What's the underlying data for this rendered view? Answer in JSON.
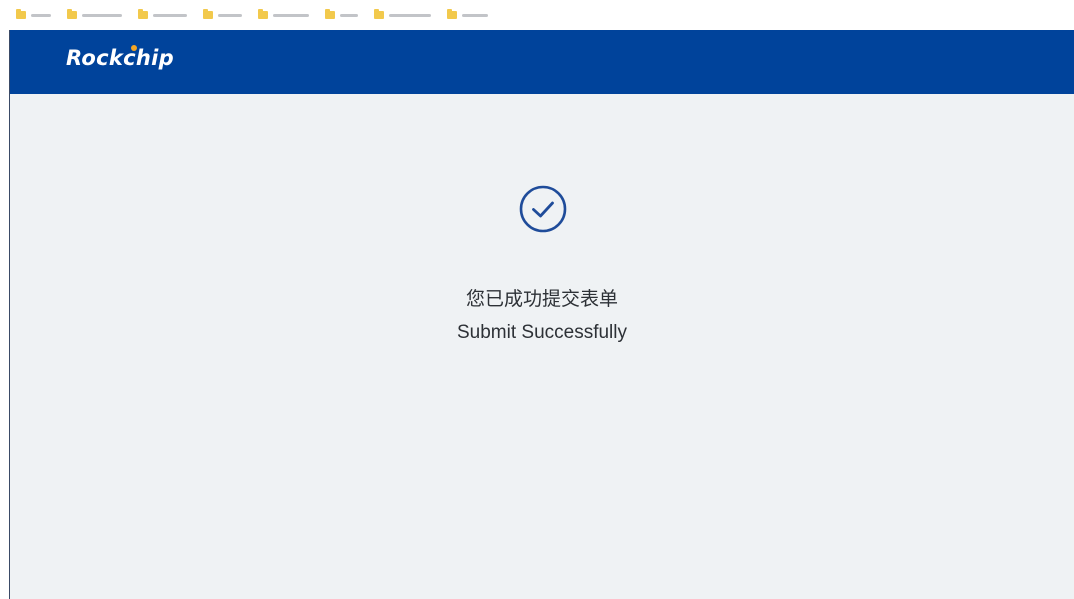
{
  "bookmarks_bar": {
    "items": [
      {
        "icon": "folder-icon"
      },
      {
        "icon": "folder-icon"
      },
      {
        "icon": "folder-icon"
      },
      {
        "icon": "folder-icon"
      },
      {
        "icon": "folder-icon"
      },
      {
        "icon": "folder-icon"
      },
      {
        "icon": "folder-icon"
      },
      {
        "icon": "folder-icon"
      }
    ]
  },
  "header": {
    "logo_text": "Rockchip",
    "background_color": "#00439b"
  },
  "main": {
    "icon": "check-circle-icon",
    "icon_color": "#1f4c9a",
    "title": "您已成功提交表单",
    "subtitle": "Submit Successfully",
    "background_color": "#eff2f4"
  }
}
